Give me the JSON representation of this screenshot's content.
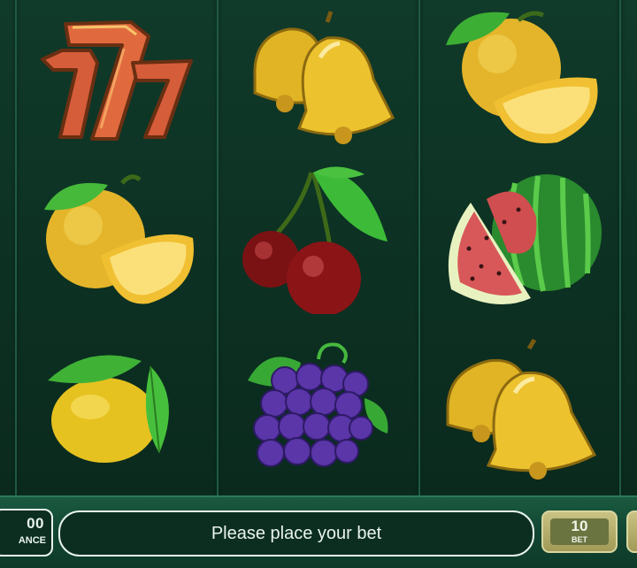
{
  "reels": [
    [
      "seven",
      "orange",
      "lemon"
    ],
    [
      "bell",
      "cherry",
      "grapes"
    ],
    [
      "orange",
      "watermelon",
      "bell"
    ]
  ],
  "balance": {
    "value": "00",
    "label": "ANCE"
  },
  "message": "Please place your bet",
  "bet": {
    "value": "10",
    "label": "BET"
  },
  "colors": {
    "felt": "#103a2a",
    "panel": "#124632",
    "outline": "#e8f4ee",
    "bet_button": "#c9c283"
  }
}
